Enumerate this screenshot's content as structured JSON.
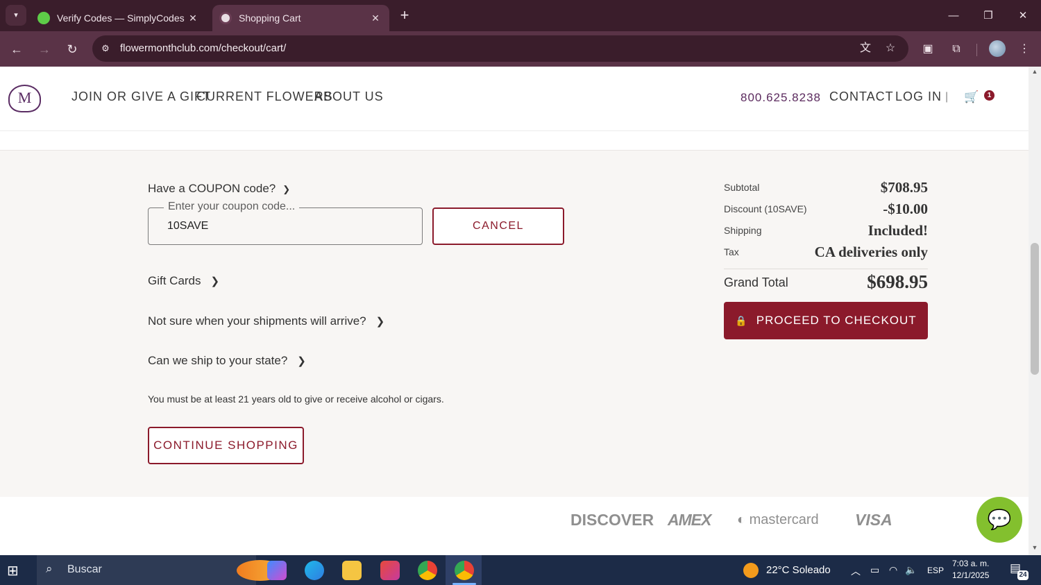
{
  "browser": {
    "tabs": [
      {
        "title": "Verify Codes — SimplyCodes",
        "close": "✕"
      },
      {
        "title": "Shopping Cart",
        "close": "✕"
      }
    ],
    "new_tab": "+",
    "url": "flowermonthclub.com/checkout/cart/",
    "window_controls": {
      "minimize": "—",
      "restore": "❐",
      "close": "✕"
    }
  },
  "site": {
    "logo_text": "M",
    "nav": [
      "JOIN OR GIVE A GIFT",
      "CURRENT FLOWERS",
      "ABOUT US"
    ],
    "phone": "800.625.8238",
    "contact": "CONTACT",
    "login": "LOG IN",
    "separator": "|",
    "cart_count": "1"
  },
  "coupon": {
    "toggle_label": "Have a COUPON code?",
    "placeholder": "Enter your coupon code...",
    "value": "10SAVE",
    "cancel_label": "CANCEL"
  },
  "links": {
    "gift_cards": "Gift Cards",
    "shipments": "Not sure when your shipments will arrive?",
    "ship_state": "Can we ship to your state?"
  },
  "age_note": "You must be at least 21 years old to give or receive alcohol or cigars.",
  "continue_label": "CONTINUE SHOPPING",
  "summary": {
    "subtotal_label": "Subtotal",
    "subtotal_value": "$708.95",
    "discount_label": "Discount (10SAVE)",
    "discount_value": "-$10.00",
    "shipping_label": "Shipping",
    "shipping_value": "Included!",
    "tax_label": "Tax",
    "tax_value": "CA deliveries only",
    "grand_label": "Grand Total",
    "grand_value": "$698.95",
    "checkout_label": "PROCEED TO CHECKOUT"
  },
  "payments": [
    "DISCOVER",
    "AMEX",
    "mastercard",
    "VISA"
  ],
  "taskbar": {
    "search_text": "Buscar",
    "weather": "22°C  Soleado",
    "lang": "ESP",
    "time": "7:03 a. m.",
    "date": "12/1/2025",
    "notifications": "24"
  },
  "colors": {
    "brand": "#8b1a2b",
    "phone": "#5b2a5e",
    "chat": "#83c02e"
  }
}
